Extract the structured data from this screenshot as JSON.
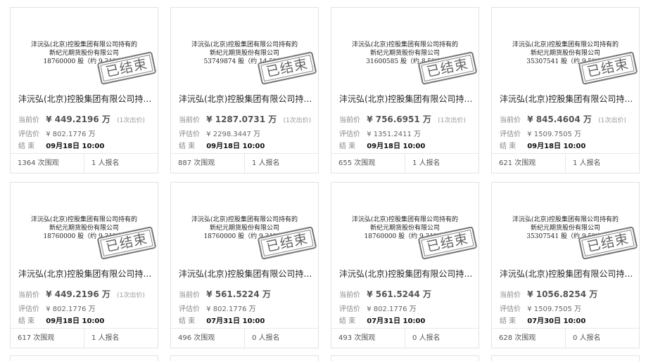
{
  "labels": {
    "current_price": "当前价",
    "eval_price": "评估价",
    "end": "结  束",
    "ended_stamp": "已结束"
  },
  "cards": [
    {
      "doc_line1": "沣沅弘(北京)控股集团有限公司持有的",
      "doc_line2": "新纪元期货股份有限公司",
      "doc_line3": "18760000 股（约 9.31%）",
      "title": "沣沅弘(北京)控股集团有限公司持有…",
      "current_price": "¥ 449.2196 万",
      "bids": "(1次出价)",
      "eval_price": "¥ 802.1776 万",
      "end_time": "09月18日 10:00",
      "views": "1364 次围观",
      "signups": "1 人报名"
    },
    {
      "doc_line1": "沣沅弘(北京)控股集团有限公司持有的",
      "doc_line2": "新纪元期货股份有限公司",
      "doc_line3": "53749874 股（约 14.5%）",
      "title": "沣沅弘(北京)控股集团有限公司持有…",
      "current_price": "¥ 1287.0731 万",
      "bids": "(1次出价)",
      "eval_price": "¥ 2298.3447 万",
      "end_time": "09月18日 10:00",
      "views": "887 次围观",
      "signups": "1 人报名"
    },
    {
      "doc_line1": "沣沅弘(北京)控股集团有限公司持有的",
      "doc_line2": "新纪元期货股份有限公司",
      "doc_line3": "31600585 股（约 8.5%）",
      "title": "沣沅弘(北京)控股集团有限公司持有…",
      "current_price": "¥ 756.6951 万",
      "bids": "(1次出价)",
      "eval_price": "¥ 1351.2411 万",
      "end_time": "09月18日 10:00",
      "views": "655 次围观",
      "signups": "1 人报名"
    },
    {
      "doc_line1": "沣沅弘(北京)控股集团有限公司持有的",
      "doc_line2": "新纪元期货股份有限公司",
      "doc_line3": "35307541 股（约 9.5%）",
      "title": "沣沅弘(北京)控股集团有限公司持有…",
      "current_price": "¥ 845.4604 万",
      "bids": "(1次出价)",
      "eval_price": "¥ 1509.7505 万",
      "end_time": "09月18日 10:00",
      "views": "621 次围观",
      "signups": "1 人报名"
    },
    {
      "doc_line1": "沣沅弘(北京)控股集团有限公司持有的",
      "doc_line2": "新纪元期货股份有限公司",
      "doc_line3": "18760000 股（约 9.31%）",
      "title": "沣沅弘(北京)控股集团有限公司持有…",
      "current_price": "¥ 449.2196 万",
      "bids": "(1次出价)",
      "eval_price": "¥ 802.1776 万",
      "end_time": "09月18日 10:00",
      "views": "617 次围观",
      "signups": "1 人报名"
    },
    {
      "doc_line1": "沣沅弘(北京)控股集团有限公司持有的",
      "doc_line2": "新纪元期货股份有限公司",
      "doc_line3": "18760000 股（约 9.31%）",
      "title": "沣沅弘(北京)控股集团有限公司持有…",
      "current_price": "¥ 561.5224 万",
      "bids": "",
      "eval_price": "¥ 802.1776 万",
      "end_time": "07月31日 10:00",
      "views": "496 次围观",
      "signups": "0 人报名"
    },
    {
      "doc_line1": "沣沅弘(北京)控股集团有限公司持有的",
      "doc_line2": "新纪元期货股份有限公司",
      "doc_line3": "18760000 股（约 9.31%）",
      "title": "沣沅弘(北京)控股集团有限公司持有…",
      "current_price": "¥ 561.5244 万",
      "bids": "",
      "eval_price": "¥ 802.1776 万",
      "end_time": "07月31日 10:00",
      "views": "493 次围观",
      "signups": "0 人报名"
    },
    {
      "doc_line1": "沣沅弘(北京)控股集团有限公司持有的",
      "doc_line2": "新纪元期货股份有限公司",
      "doc_line3": "35307541 股（约 9.5%）",
      "title": "沣沅弘(北京)控股集团有限公司持有…",
      "current_price": "¥ 1056.8254 万",
      "bids": "",
      "eval_price": "¥ 1509.7505 万",
      "end_time": "07月30日 10:00",
      "views": "628 次围观",
      "signups": "0 人报名"
    }
  ]
}
